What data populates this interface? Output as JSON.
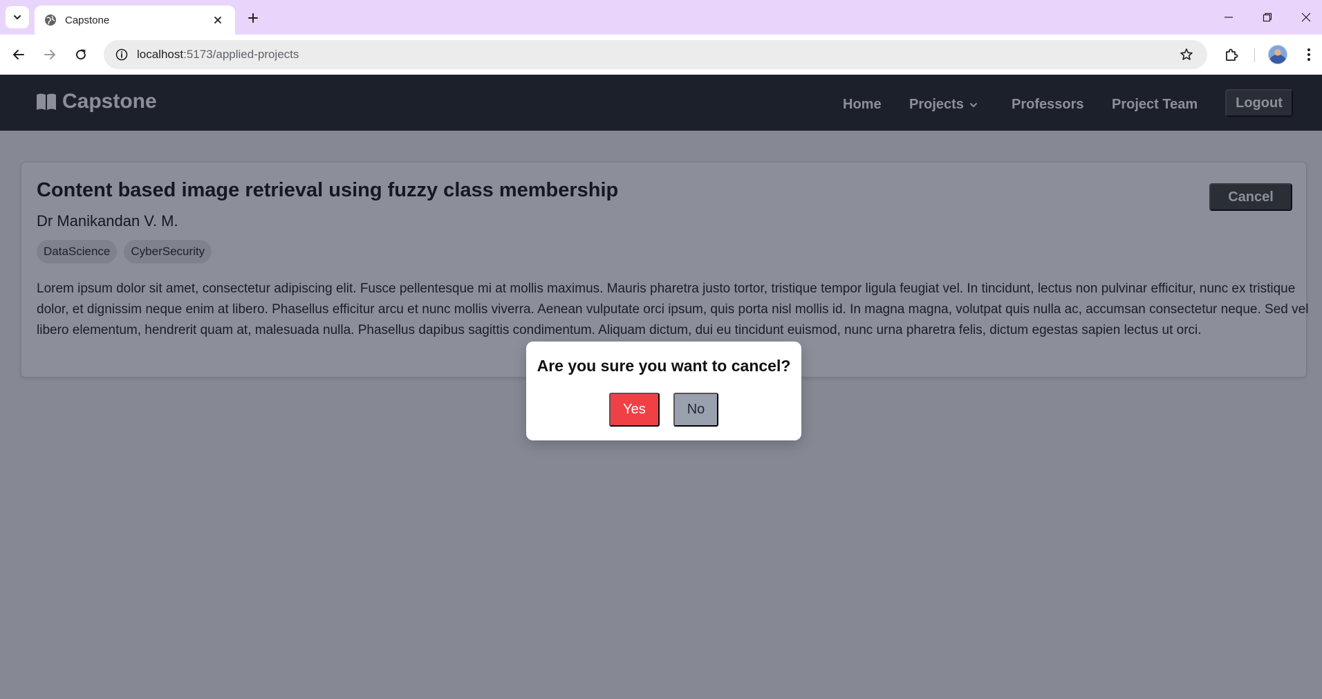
{
  "browser": {
    "tab_title": "Capstone",
    "url_host": "localhost",
    "url_path": ":5173/applied-projects"
  },
  "navbar": {
    "brand": "Capstone",
    "brand_icon": "book-open-icon",
    "links": {
      "home": "Home",
      "projects": "Projects",
      "professors": "Professors",
      "project_team": "Project Team"
    },
    "logout": "Logout"
  },
  "project": {
    "title": "Content based image retrieval using fuzzy class membership",
    "professor": "Dr Manikandan V. M.",
    "tags": [
      "DataScience",
      "CyberSecurity"
    ],
    "description": "Lorem ipsum dolor sit amet, consectetur adipiscing elit. Fusce pellentesque mi at mollis maximus. Mauris pharetra justo tortor, tristique tempor ligula feugiat vel. In tincidunt, lectus non pulvinar efficitur, nunc ex tristique dolor, et dignissim neque enim at libero. Phasellus efficitur arcu et nunc mollis viverra. Aenean vulputate orci ipsum, quis porta nisl mollis id. In magna magna, volutpat quis nulla ac, accumsan consectetur neque. Sed vel libero elementum, hendrerit quam at, malesuada nulla. Phasellus dapibus sagittis condimentum. Aliquam dictum, dui eu tincidunt euismod, nunc urna pharetra felis, dictum egestas sapien lectus ut orci.",
    "cancel_label": "Cancel"
  },
  "modal": {
    "question": "Are you sure you want to cancel?",
    "yes": "Yes",
    "no": "No"
  },
  "colors": {
    "navbar_bg": "#1f2121",
    "yes_button": "#ef4046",
    "no_button": "#9aa1ae",
    "overlay": "rgba(26,32,52,0.5)"
  }
}
